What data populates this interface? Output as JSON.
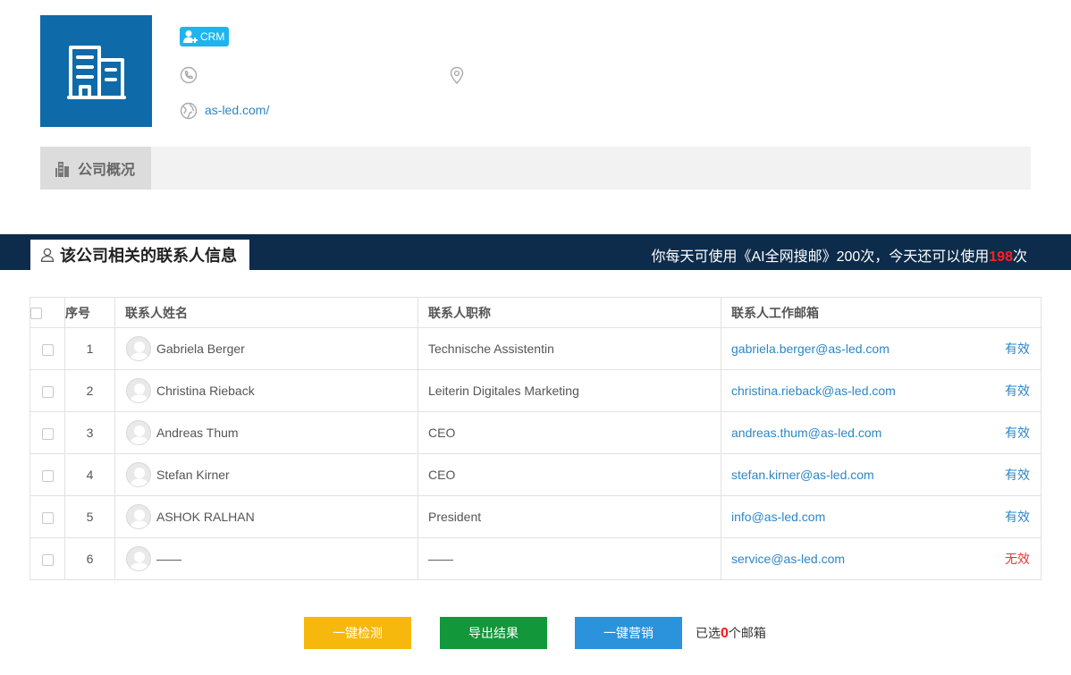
{
  "company": {
    "badge_label": "CRM",
    "website": "as-led.com/"
  },
  "overview_tab": {
    "label": "公司概况"
  },
  "contacts_section": {
    "title": "该公司相关的联系人信息",
    "quota_prefix": "你每天可使用《AI全网搜邮》200次，今天还可以使用",
    "quota_remaining": "198",
    "quota_suffix": "次"
  },
  "table": {
    "headers": {
      "no": "序号",
      "name": "联系人姓名",
      "title": "联系人职称",
      "email": "联系人工作邮箱"
    },
    "rows": [
      {
        "no": "1",
        "name": "Gabriela Berger",
        "title": "Technische Assistentin",
        "email": "gabriela.berger@as-led.com",
        "status": "有效"
      },
      {
        "no": "2",
        "name": "Christina Rieback",
        "title": "Leiterin Digitales Marketing",
        "email": "christina.rieback@as-led.com",
        "status": "有效"
      },
      {
        "no": "3",
        "name": "Andreas Thum",
        "title": "CEO",
        "email": "andreas.thum@as-led.com",
        "status": "有效"
      },
      {
        "no": "4",
        "name": "Stefan Kirner",
        "title": "CEO",
        "email": "stefan.kirner@as-led.com",
        "status": "有效"
      },
      {
        "no": "5",
        "name": "ASHOK RALHAN",
        "title": "President",
        "email": "info@as-led.com",
        "status": "有效"
      },
      {
        "no": "6",
        "name": "——",
        "title": "——",
        "email": "service@as-led.com",
        "status": "无效"
      }
    ]
  },
  "actions": {
    "check_label": "一键检测",
    "export_label": "导出结果",
    "market_label": "一键营销",
    "selected_prefix": "已选",
    "selected_count": "0",
    "selected_suffix": "个邮箱"
  },
  "colors": {
    "logo_bg": "#0e6aa8",
    "banner_bg": "#0d2c4b",
    "link": "#2d86c5",
    "invalid": "#e0393e",
    "check_btn": "#f6b80d",
    "export_btn": "#12973a",
    "market_btn": "#2a93dc"
  }
}
